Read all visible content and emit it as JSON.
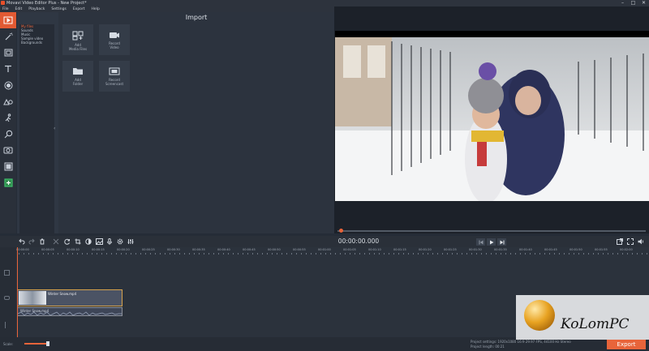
{
  "window": {
    "title": "Movavi Video Editor Plus - New Project*",
    "minimize": "–",
    "maximize": "□",
    "close": "✕"
  },
  "menu": [
    "File",
    "Edit",
    "Playback",
    "Settings",
    "Export",
    "Help"
  ],
  "left_toolbar": [
    {
      "icon": "import-icon",
      "active": true
    },
    {
      "icon": "magic-wand-icon"
    },
    {
      "icon": "filters-icon"
    },
    {
      "icon": "titles-icon"
    },
    {
      "icon": "stickers-icon"
    },
    {
      "icon": "callouts-icon"
    },
    {
      "icon": "transitions-icon"
    },
    {
      "icon": "zoom-icon"
    },
    {
      "icon": "stabilization-icon"
    },
    {
      "icon": "chroma-key-icon"
    },
    {
      "icon": "store-icon"
    }
  ],
  "categories": [
    "My files",
    "Sounds",
    "Music",
    "Sample video",
    "Backgrounds"
  ],
  "import": {
    "title": "Import",
    "tiles": [
      {
        "label": "Add\nMedia Files",
        "icon": "add-media-icon"
      },
      {
        "label": "Record\nVideo",
        "icon": "camera-icon"
      },
      {
        "label": "Add\nFolder",
        "icon": "folder-icon"
      },
      {
        "label": "Record\nScreencast",
        "icon": "screencast-icon"
      }
    ]
  },
  "player": {
    "timecode": "00:00:00.000"
  },
  "timeline": {
    "ruler": [
      "00:00:00",
      "00:00:05",
      "00:00:10",
      "00:00:15",
      "00:00:20",
      "00:00:25",
      "00:00:30",
      "00:00:35",
      "00:00:40",
      "00:00:45",
      "00:00:50",
      "00:00:55",
      "00:01:00",
      "00:01:05",
      "00:01:10",
      "00:01:15",
      "00:01:20",
      "00:01:25",
      "00:01:30",
      "00:01:35",
      "00:01:40",
      "00:01:45",
      "00:01:50",
      "00:01:55",
      "00:02:00",
      "00:02:05"
    ],
    "video_clip": "Winter Snow.mp4",
    "audio_clip": "Winter Snow.mp4"
  },
  "bottom": {
    "scale_label": "Scale:",
    "project_settings": "Project settings: 1920x1080 16:9 29.97 FPS, 44100 Hz Stereo",
    "project_length": "Project length: 00:21",
    "export_label": "Export"
  },
  "watermark": {
    "text": "KoLomPC"
  },
  "colors": {
    "accent": "#e8643a",
    "panel": "#2c333e"
  }
}
